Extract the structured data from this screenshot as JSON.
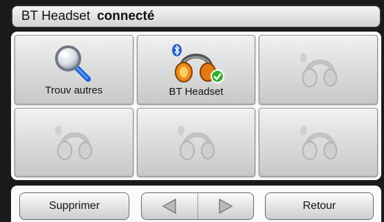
{
  "title_bar": {
    "device_name": "BT Headset",
    "status": "connecté"
  },
  "tiles": [
    {
      "label": "Trouv autres",
      "icon": "magnifier-icon",
      "state": "search"
    },
    {
      "label": "BT Headset",
      "icon": "headset-icon",
      "state": "connected"
    },
    {
      "label": "",
      "icon": "headset-icon",
      "state": "empty"
    },
    {
      "label": "",
      "icon": "headset-icon",
      "state": "empty"
    },
    {
      "label": "",
      "icon": "headset-icon",
      "state": "empty"
    },
    {
      "label": "",
      "icon": "headset-icon",
      "state": "empty"
    }
  ],
  "bottom_bar": {
    "delete_label": "Supprimer",
    "back_label": "Retour"
  },
  "colors": {
    "connected_badge": "#2eae2e",
    "bluetooth": "#2a62c8",
    "headset_active": "#f08a1c"
  }
}
